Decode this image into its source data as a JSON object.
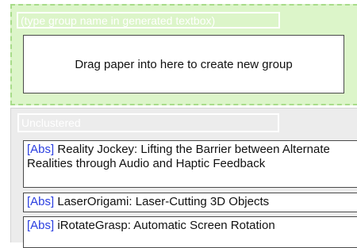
{
  "new_group": {
    "name_placeholder": "(type group name in generated textbox)",
    "drop_hint": "Drag paper into here to create new group"
  },
  "unclustered": {
    "name_value": "Unclustered",
    "papers": [
      {
        "abs_label": "[Abs]",
        "title": "Reality Jockey: Lifting the Barrier between Alternate Realities through Audio and Haptic Feedback"
      },
      {
        "abs_label": "[Abs]",
        "title": "LaserOrigami: Laser-Cutting 3D Objects"
      },
      {
        "abs_label": "[Abs]",
        "title": "iRotateGrasp: Automatic Screen Rotation"
      }
    ]
  },
  "colors": {
    "new_group_bg": "#dcf5c9",
    "new_group_border": "#a8dc8a",
    "unclustered_bg": "#ececec",
    "link": "#2a3ee0"
  }
}
